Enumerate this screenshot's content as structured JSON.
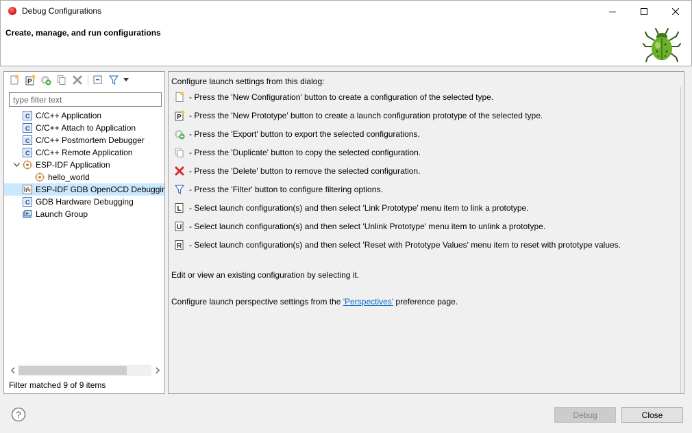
{
  "window": {
    "title": "Debug Configurations",
    "header_title": "Create, manage, and run configurations"
  },
  "toolbar": {
    "buttons": [
      "new-config-icon",
      "new-prototype-icon",
      "export-icon",
      "duplicate-icon",
      "delete-icon",
      "collapse-all-icon",
      "filter-icon",
      "dropdown-icon"
    ]
  },
  "filter": {
    "placeholder": "type filter text",
    "status": "Filter matched 9 of 9 items"
  },
  "tree": {
    "items": [
      {
        "label": "C/C++ Application",
        "icon": "c-app-icon"
      },
      {
        "label": "C/C++ Attach to Application",
        "icon": "c-app-icon"
      },
      {
        "label": "C/C++ Postmortem Debugger",
        "icon": "c-app-icon"
      },
      {
        "label": "C/C++ Remote Application",
        "icon": "c-app-icon"
      },
      {
        "label": "ESP-IDF Application",
        "icon": "esp-idf-icon",
        "expanded": true
      },
      {
        "label": "hello_world",
        "icon": "esp-idf-icon",
        "child": true
      },
      {
        "label": "ESP-IDF GDB OpenOCD Debugging",
        "icon": "openocd-icon",
        "selected": true
      },
      {
        "label": "GDB Hardware Debugging",
        "icon": "c-app-icon"
      },
      {
        "label": "Launch Group",
        "icon": "launch-group-icon"
      }
    ]
  },
  "help": {
    "intro": "Configure launch settings from this dialog:",
    "rows": [
      {
        "icon": "new-config-icon",
        "text": "- Press the 'New Configuration' button to create a configuration of the selected type."
      },
      {
        "icon": "new-prototype-icon",
        "text": "- Press the 'New Prototype' button to create a launch configuration prototype of the selected type."
      },
      {
        "icon": "export-icon",
        "text": "- Press the 'Export' button to export the selected configurations."
      },
      {
        "icon": "duplicate-icon",
        "text": "- Press the 'Duplicate' button to copy the selected configuration."
      },
      {
        "icon": "delete-icon",
        "text": "- Press the 'Delete' button to remove the selected configuration."
      },
      {
        "icon": "filter-icon",
        "text": "- Press the 'Filter' button to configure filtering options."
      },
      {
        "icon": "link-prototype-icon",
        "text": "- Select launch configuration(s) and then select 'Link Prototype' menu item to link a prototype."
      },
      {
        "icon": "unlink-prototype-icon",
        "text": "- Select launch configuration(s) and then select 'Unlink Prototype' menu item to unlink a prototype."
      },
      {
        "icon": "reset-prototype-icon",
        "text": "- Select launch configuration(s) and then select 'Reset with Prototype Values' menu item to reset with prototype values."
      }
    ],
    "edit_text": "Edit or view an existing configuration by selecting it.",
    "perspective_prefix": "Configure launch perspective settings from the ",
    "perspective_link": "'Perspectives'",
    "perspective_suffix": " preference page."
  },
  "buttons": {
    "debug": "Debug",
    "close": "Close"
  }
}
